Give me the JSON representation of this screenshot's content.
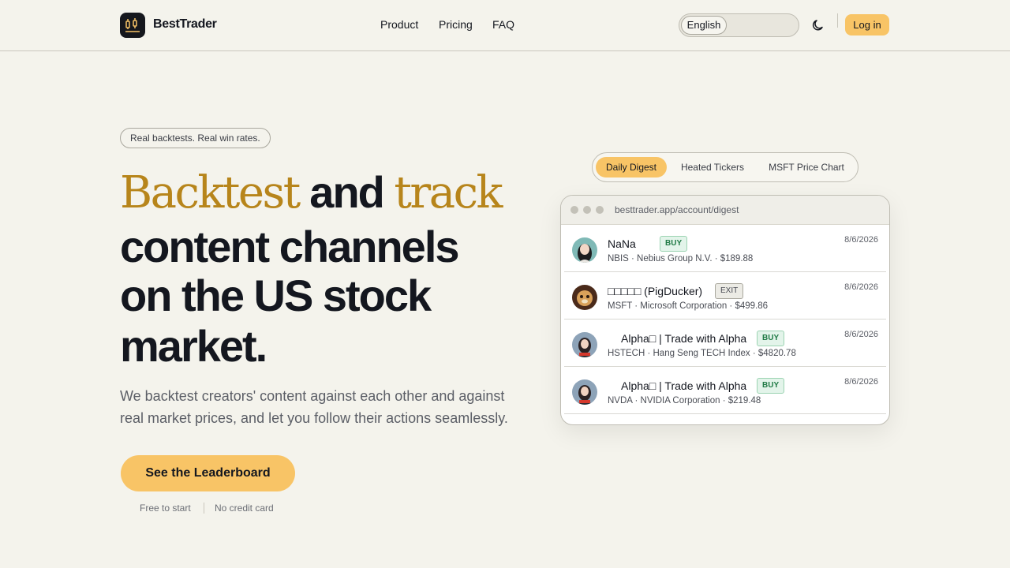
{
  "brand": {
    "name": "BestTrader",
    "logo_icon": "candlestick-icon"
  },
  "nav": {
    "items": [
      {
        "label": "Product"
      },
      {
        "label": "Pricing"
      },
      {
        "label": "FAQ"
      }
    ]
  },
  "header": {
    "language": "English",
    "theme_icon": "moon-icon",
    "login_label": "Log in"
  },
  "hero": {
    "tagline": "Real backtests. Real win rates.",
    "headline_w1": "Backtest",
    "headline_w2": "and",
    "headline_w3": "track",
    "headline_l2": "content channels",
    "headline_l3": "on the US stock",
    "headline_l4": "market.",
    "subtitle": "We backtest creators' content against each other and against real market prices, and let you follow their actions seamlessly.",
    "cta_label": "See the Leaderboard",
    "note_1": "Free to start",
    "note_2": "No credit card"
  },
  "preview": {
    "tabs": [
      {
        "label": "Daily Digest",
        "active": true
      },
      {
        "label": "Heated Tickers"
      },
      {
        "label": "MSFT Price Chart"
      }
    ],
    "url": "besttrader.app/account/digest",
    "rows": [
      {
        "name": "NaNa",
        "badge": "BUY",
        "detail": "NBIS · Nebius Group N.V. · $189.88",
        "date": "8/6/2026"
      },
      {
        "name": "□□□□□ (PigDucker)",
        "badge": "EXIT",
        "detail": "MSFT · Microsoft Corporation · $499.86",
        "date": "8/6/2026"
      },
      {
        "name": "Alpha□ | Trade with Alpha",
        "badge": "BUY",
        "detail": "HSTECH · Hang Seng TECH Index · $4820.78",
        "date": "8/6/2026"
      },
      {
        "name": "Alpha□ | Trade with Alpha",
        "badge": "BUY",
        "detail": "NVDA · NVIDIA Corporation · $219.48",
        "date": "8/6/2026"
      }
    ]
  },
  "colors": {
    "background": "#f4f3ec",
    "accent": "#f8c466",
    "serif_gold": "#b7851b",
    "buy_green": "#1f7a45"
  }
}
